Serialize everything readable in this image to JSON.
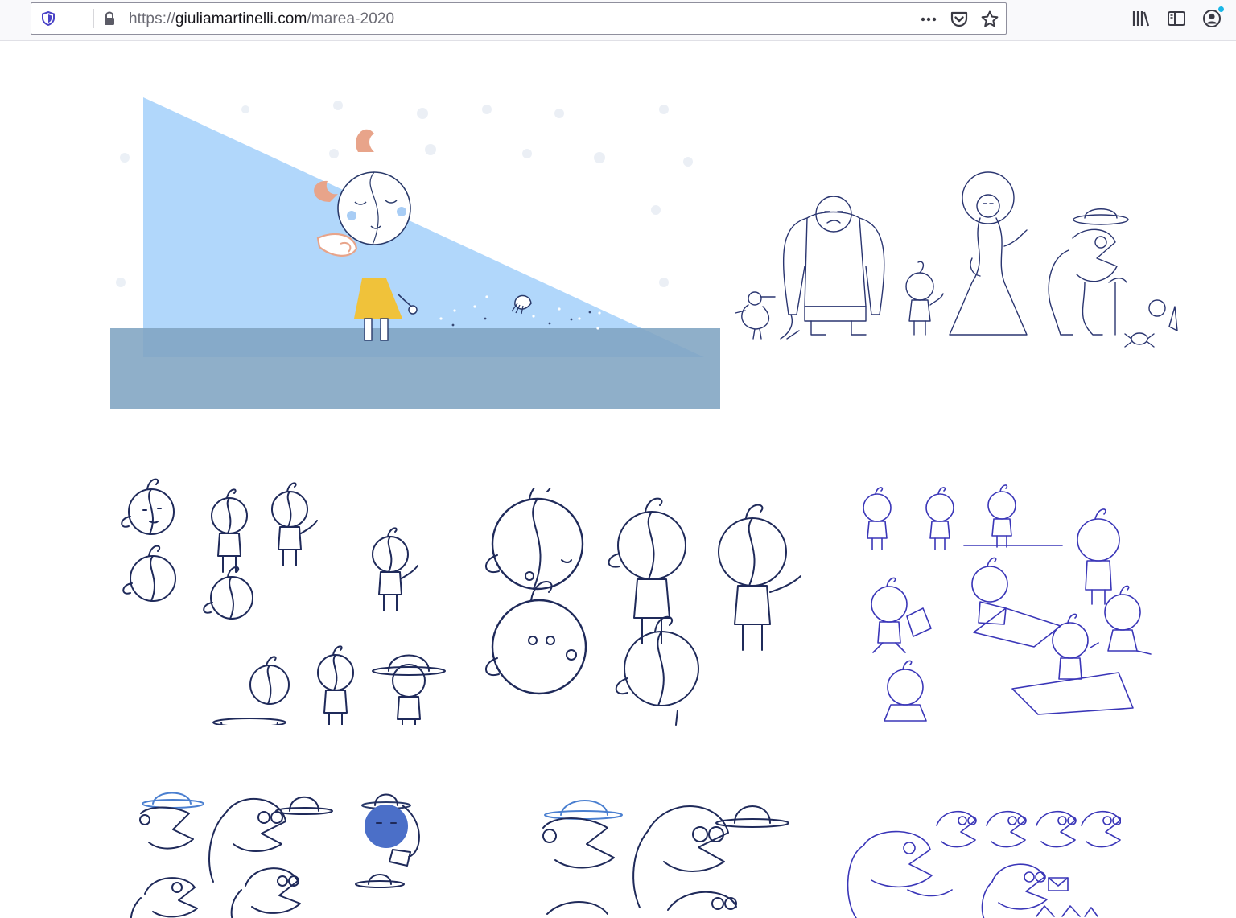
{
  "browser": {
    "url_scheme": "https://",
    "url_host": "giuliamartinelli.com",
    "url_path": "/marea-2020",
    "icons": {
      "tracking": "shield-icon",
      "security": "lock-icon",
      "page_actions": "more-icon",
      "pocket": "pocket-icon",
      "bookmark": "star-icon",
      "library": "library-icon",
      "sidebar": "sidebar-icon",
      "account": "account-icon"
    },
    "accent_color": "#1bb7e6"
  },
  "gallery": {
    "hero": {
      "name": "hero-illustration",
      "colors": {
        "light_ray": "#a9d3fb",
        "sea": "#8fb0cb",
        "hair": "#e8a48a",
        "dress": "#f0c23a",
        "cheek": "#a8cdf5"
      }
    },
    "items": [
      {
        "name": "character-lineup"
      },
      {
        "name": "girl-sketch-sheet-1"
      },
      {
        "name": "girl-sketch-sheet-2"
      },
      {
        "name": "girl-sketch-sheet-3"
      },
      {
        "name": "old-man-sketch-sheet-1"
      },
      {
        "name": "old-man-sketch-sheet-2"
      },
      {
        "name": "old-man-sketch-sheet-3"
      }
    ]
  }
}
